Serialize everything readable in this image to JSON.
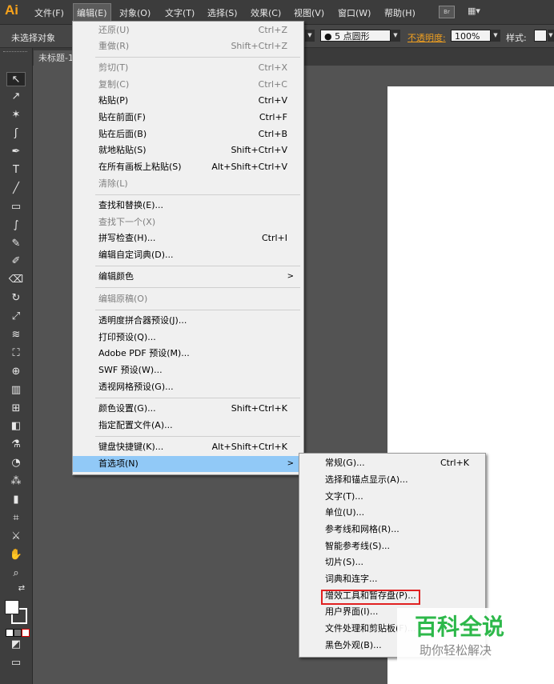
{
  "app": {
    "logo": "Ai"
  },
  "menubar": {
    "items": [
      "文件(F)",
      "编辑(E)",
      "对象(O)",
      "文字(T)",
      "选择(S)",
      "效果(C)",
      "视图(V)",
      "窗口(W)",
      "帮助(H)"
    ],
    "bridge_label": "Br",
    "arrange_label": "▦▾"
  },
  "controlbar": {
    "selection_status": "未选择对象",
    "brush_value": "● 5 点圆形",
    "opacity_label": "不透明度:",
    "opacity_value": "100%",
    "style_label": "样式:"
  },
  "document": {
    "tab_title": "未标题-1"
  },
  "tools": {
    "selection": "↖",
    "direct_selection": "↗",
    "magic_wand": "✶",
    "lasso": "ʃ",
    "pen": "✒",
    "type": "T",
    "line": "╱",
    "rectangle": "▭",
    "paintbrush": "∫",
    "pencil": "✎",
    "blob_brush": "✐",
    "eraser": "⌫",
    "rotate": "↻",
    "scale": "⤢",
    "warp": "≋",
    "free_transform": "⛶",
    "shape_builder": "⊕",
    "perspective_grid": "▥",
    "mesh": "⊞",
    "gradient": "◧",
    "eyedropper": "⚗",
    "blend": "◔",
    "symbol_sprayer": "⁂",
    "column_graph": "▮",
    "artboard": "⌗",
    "slice": "⚔",
    "hand": "✋",
    "zoom": "⌕",
    "swap_colors": "⇄",
    "draw_mode": "◩",
    "screen_mode": "▭"
  },
  "edit_menu": {
    "items": [
      {
        "label": "还原(U)",
        "shortcut": "Ctrl+Z"
      },
      {
        "label": "重做(R)",
        "shortcut": "Shift+Ctrl+Z"
      },
      {
        "label": "剪切(T)",
        "shortcut": "Ctrl+X"
      },
      {
        "label": "复制(C)",
        "shortcut": "Ctrl+C"
      },
      {
        "label": "粘贴(P)",
        "shortcut": "Ctrl+V"
      },
      {
        "label": "贴在前面(F)",
        "shortcut": "Ctrl+F"
      },
      {
        "label": "贴在后面(B)",
        "shortcut": "Ctrl+B"
      },
      {
        "label": "就地粘贴(S)",
        "shortcut": "Shift+Ctrl+V"
      },
      {
        "label": "在所有画板上粘贴(S)",
        "shortcut": "Alt+Shift+Ctrl+V"
      },
      {
        "label": "清除(L)",
        "shortcut": ""
      },
      {
        "label": "查找和替换(E)...",
        "shortcut": ""
      },
      {
        "label": "查找下一个(X)",
        "shortcut": ""
      },
      {
        "label": "拼写检查(H)...",
        "shortcut": "Ctrl+I"
      },
      {
        "label": "编辑自定词典(D)...",
        "shortcut": ""
      },
      {
        "label": "编辑颜色",
        "shortcut": ""
      },
      {
        "label": "编辑原稿(O)",
        "shortcut": ""
      },
      {
        "label": "透明度拼合器预设(J)...",
        "shortcut": ""
      },
      {
        "label": "打印预设(Q)...",
        "shortcut": ""
      },
      {
        "label": "Adobe PDF 预设(M)...",
        "shortcut": ""
      },
      {
        "label": "SWF 预设(W)...",
        "shortcut": ""
      },
      {
        "label": "透视网格预设(G)...",
        "shortcut": ""
      },
      {
        "label": "颜色设置(G)...",
        "shortcut": "Shift+Ctrl+K"
      },
      {
        "label": "指定配置文件(A)...",
        "shortcut": ""
      },
      {
        "label": "键盘快捷键(K)...",
        "shortcut": "Alt+Shift+Ctrl+K"
      },
      {
        "label": "首选项(N)",
        "shortcut": ""
      }
    ]
  },
  "preferences_submenu": {
    "items": [
      {
        "label": "常规(G)...",
        "shortcut": "Ctrl+K"
      },
      {
        "label": "选择和锚点显示(A)...",
        "shortcut": ""
      },
      {
        "label": "文字(T)...",
        "shortcut": ""
      },
      {
        "label": "单位(U)...",
        "shortcut": ""
      },
      {
        "label": "参考线和网格(R)...",
        "shortcut": ""
      },
      {
        "label": "智能参考线(S)...",
        "shortcut": ""
      },
      {
        "label": "切片(S)...",
        "shortcut": ""
      },
      {
        "label": "词典和连字...",
        "shortcut": ""
      },
      {
        "label": "增效工具和暂存盘(P)...",
        "shortcut": ""
      },
      {
        "label": "用户界面(I)...",
        "shortcut": ""
      },
      {
        "label": "文件处理和剪贴板(F)...",
        "shortcut": ""
      },
      {
        "label": "黑色外观(B)...",
        "shortcut": ""
      }
    ]
  },
  "watermark": {
    "title": "百科全说",
    "subtitle": "助你轻松解决"
  },
  "colors": {
    "accent_logo": "#f7a21b",
    "menu_highlight": "#91c9f7",
    "callout_red": "#e02020",
    "watermark_green": "#2db84a"
  }
}
